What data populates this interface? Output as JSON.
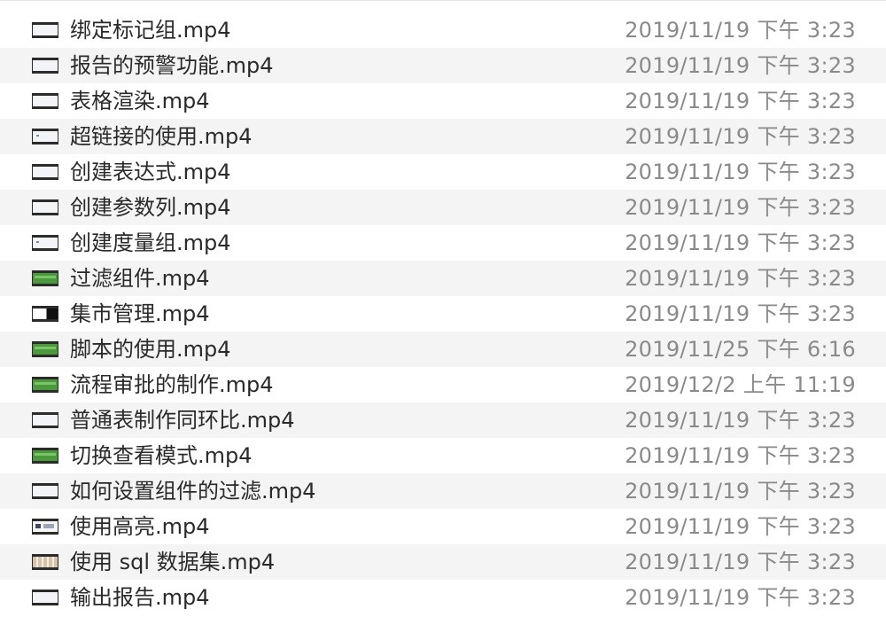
{
  "files": [
    {
      "name": "绑定标记组.mp4",
      "date": "2019/11/19 下午 3:23",
      "thumb": "plain"
    },
    {
      "name": "报告的预警功能.mp4",
      "date": "2019/11/19 下午 3:23",
      "thumb": "plain"
    },
    {
      "name": "表格渲染.mp4",
      "date": "2019/11/19 下午 3:23",
      "thumb": "plain"
    },
    {
      "name": "超链接的使用.mp4",
      "date": "2019/11/19 下午 3:23",
      "thumb": "dots"
    },
    {
      "name": "创建表达式.mp4",
      "date": "2019/11/19 下午 3:23",
      "thumb": "plain"
    },
    {
      "name": "创建参数列.mp4",
      "date": "2019/11/19 下午 3:23",
      "thumb": "plain"
    },
    {
      "name": "创建度量组.mp4",
      "date": "2019/11/19 下午 3:23",
      "thumb": "dots"
    },
    {
      "name": "过滤组件.mp4",
      "date": "2019/11/19 下午 3:23",
      "thumb": "green"
    },
    {
      "name": "集市管理.mp4",
      "date": "2019/11/19 下午 3:23",
      "thumb": "dark"
    },
    {
      "name": "脚本的使用.mp4",
      "date": "2019/11/25 下午 6:16",
      "thumb": "green"
    },
    {
      "name": "流程审批的制作.mp4",
      "date": "2019/12/2 上午 11:19",
      "thumb": "green"
    },
    {
      "name": "普通表制作同环比.mp4",
      "date": "2019/11/19 下午 3:23",
      "thumb": "plain"
    },
    {
      "name": "切换查看模式.mp4",
      "date": "2019/11/19 下午 3:23",
      "thumb": "green"
    },
    {
      "name": "如何设置组件的过滤.mp4",
      "date": "2019/11/19 下午 3:23",
      "thumb": "plain"
    },
    {
      "name": "使用高亮.mp4",
      "date": "2019/11/19 下午 3:23",
      "thumb": "blocks"
    },
    {
      "name": "使用 sql 数据集.mp4",
      "date": "2019/11/19 下午 3:23",
      "thumb": "grid"
    },
    {
      "name": "输出报告.mp4",
      "date": "2019/11/19 下午 3:23",
      "thumb": "plain"
    }
  ]
}
